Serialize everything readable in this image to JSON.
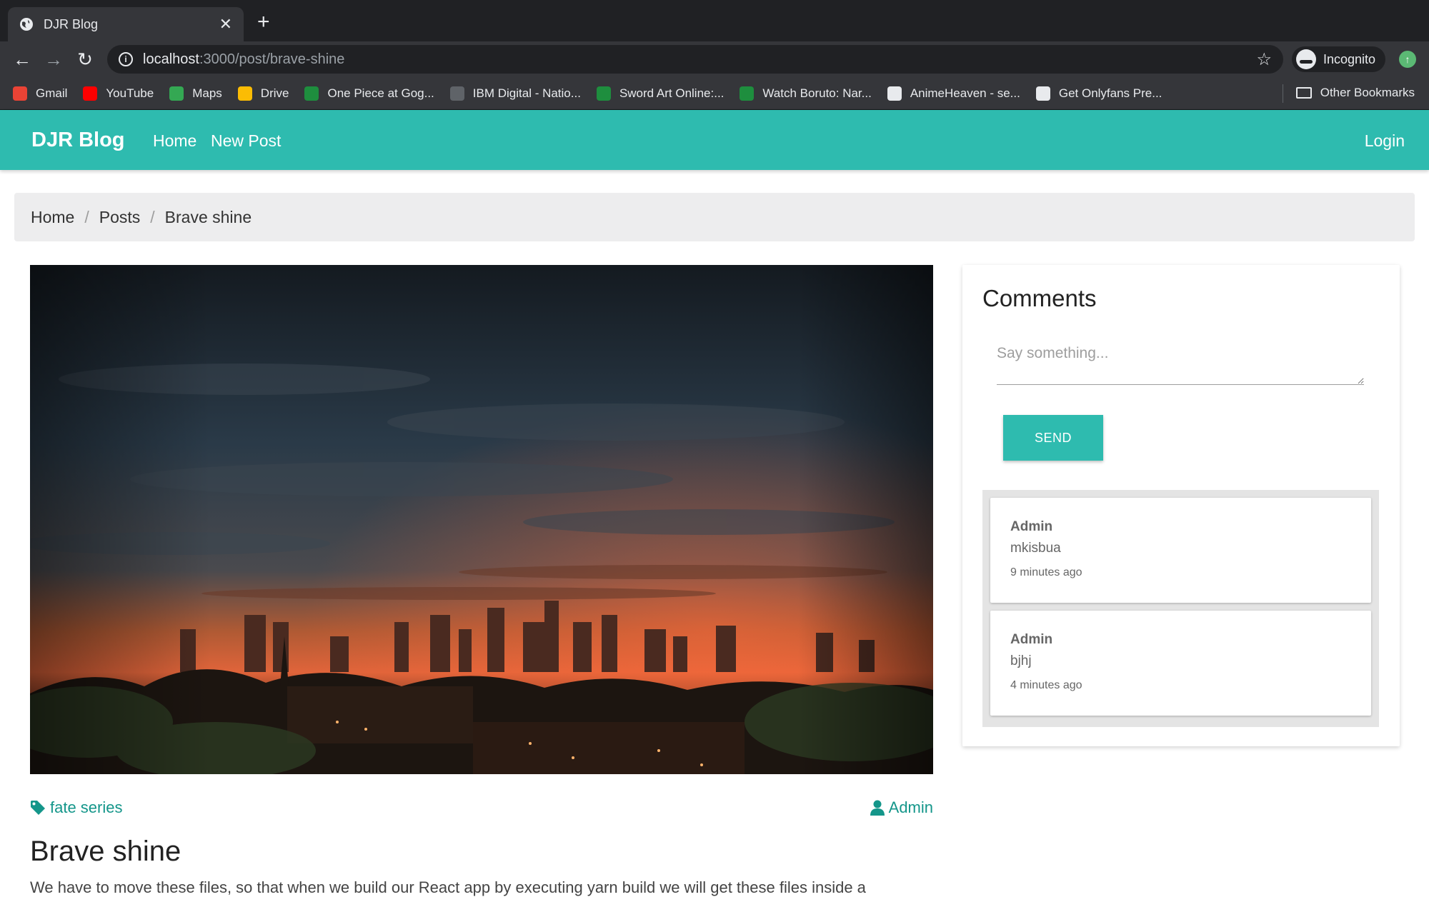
{
  "browser": {
    "tab_title": "DJR Blog",
    "url_host": "localhost",
    "url_path": ":3000/post/brave-shine",
    "profile_label": "Incognito",
    "bookmarks": [
      {
        "label": "Gmail",
        "color": "#ea4335"
      },
      {
        "label": "YouTube",
        "color": "#ff0000"
      },
      {
        "label": "Maps",
        "color": "#34a853"
      },
      {
        "label": "Drive",
        "color": "#fbbc04"
      },
      {
        "label": "One Piece at Gog...",
        "color": "#1e8e3e"
      },
      {
        "label": "IBM Digital - Natio...",
        "color": "#5f6368"
      },
      {
        "label": "Sword Art Online:...",
        "color": "#1e8e3e"
      },
      {
        "label": "Watch Boruto: Nar...",
        "color": "#1e8e3e"
      },
      {
        "label": "AnimeHeaven - se...",
        "color": "#e8eaed"
      },
      {
        "label": "Get Onlyfans Pre...",
        "color": "#e8eaed"
      }
    ],
    "other_bookmarks": "Other Bookmarks"
  },
  "nav": {
    "brand": "DJR Blog",
    "home": "Home",
    "new_post": "New Post",
    "login": "Login"
  },
  "breadcrumb": {
    "home": "Home",
    "posts": "Posts",
    "current": "Brave shine"
  },
  "post": {
    "tag": "fate series",
    "author": "Admin",
    "title": "Brave shine",
    "body": "We have to move these files, so that when we build our React app by executing yarn build we will get these files inside a"
  },
  "comments": {
    "heading": "Comments",
    "placeholder": "Say something...",
    "send_label": "SEND",
    "items": [
      {
        "author": "Admin",
        "text": "mkisbua",
        "time": "9 minutes ago"
      },
      {
        "author": "Admin",
        "text": "bjhj",
        "time": "4 minutes ago"
      }
    ]
  },
  "colors": {
    "accent": "#2ebbaf",
    "link": "#14968a"
  }
}
